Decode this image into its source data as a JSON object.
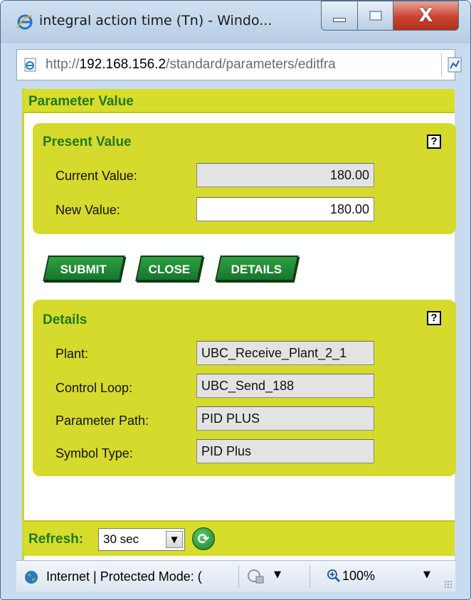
{
  "window": {
    "title": "integral action time (Tn) - Windo...",
    "close_glyph": "X"
  },
  "address": {
    "prefix": "http://",
    "host": "192.168.156.2",
    "path": "/standard/parameters/editfra"
  },
  "header": {
    "title": "Parameter Value"
  },
  "present_value": {
    "title": "Present Value",
    "help": "?",
    "current_label": "Current Value:",
    "current_value": "180.00",
    "new_label": "New Value:",
    "new_value": "180.00"
  },
  "buttons": {
    "submit": "SUBMIT",
    "close": "CLOSE",
    "details": "DETAILS"
  },
  "details": {
    "title": "Details",
    "help": "?",
    "plant_label": "Plant:",
    "plant_value": "UBC_Receive_Plant_2_1",
    "loop_label": "Control Loop:",
    "loop_value": "UBC_Send_188",
    "path_label": "Parameter Path:",
    "path_value": "PID PLUS",
    "symbol_label": "Symbol Type:",
    "symbol_value": "PID Plus"
  },
  "refresh": {
    "label": "Refresh:",
    "selected": "30 sec"
  },
  "status": {
    "zone_text": "Internet | Protected Mode: (",
    "zoom": "100%"
  },
  "colors": {
    "band": "#d8dc2a",
    "panel": "#d5da2c",
    "title_green": "#1f7a1c",
    "button_green": "#16762b"
  },
  "icons": [
    "ie-logo-icon",
    "page-icon",
    "rss-feed-icon",
    "globe-icon",
    "security-lock-icon",
    "zoom-icon",
    "refresh-icon",
    "help-icon"
  ]
}
